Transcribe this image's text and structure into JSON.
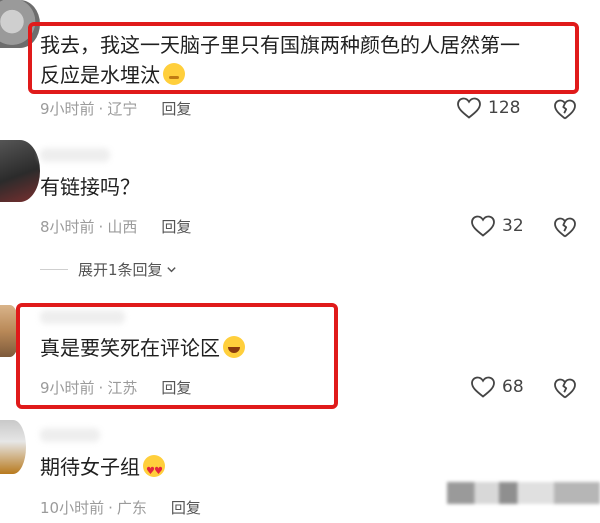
{
  "comments": [
    {
      "text_line1": "我去，我这一天脑子里只有国旗两种颜色的人居然第一",
      "text_line2": "反应是水埋汰",
      "emoji": "drooling-face-emoji",
      "time": "9小时前",
      "location": "辽宁",
      "reply_label": "回复",
      "likes": "128",
      "highlighted": true
    },
    {
      "text": "有链接吗？",
      "time": "8小时前",
      "location": "山西",
      "reply_label": "回复",
      "likes": "32",
      "expand_label": "展开1条回复",
      "highlighted": false
    },
    {
      "text": "真是要笑死在评论区",
      "emoji": "rolling-on-floor-laughing-emoji",
      "time": "9小时前",
      "location": "江苏",
      "reply_label": "回复",
      "likes": "68",
      "highlighted": true
    },
    {
      "text": "期待女子组",
      "emoji": "heart-eyes-emoji",
      "time": "10小时前",
      "location": "广东",
      "reply_label": "回复",
      "highlighted": false
    }
  ],
  "meta_separator": "·",
  "colors": {
    "highlight_border": "#e01a1a",
    "meta_text": "#9b9b9b",
    "reply_text": "#555555",
    "body_text": "#1f1f1f"
  }
}
